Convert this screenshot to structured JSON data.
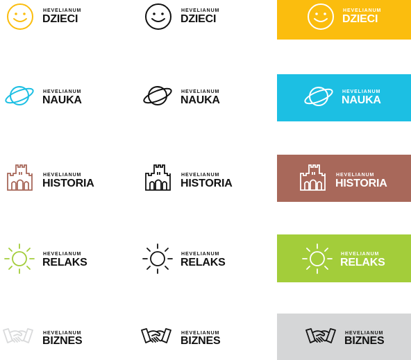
{
  "brand": "HEVELIANUM",
  "colors": {
    "black": "#111111",
    "white": "#ffffff",
    "dzieci": "#fbbd0e",
    "nauka": "#1cbfe3",
    "historia": "#a8685a",
    "relaks": "#a3cd3a",
    "biznes_light": "#d9dadb",
    "biznes_panel": "#d5d6d7"
  },
  "logos": [
    {
      "key": "dzieci",
      "word": "DZIECI",
      "icon": "smiley-icon"
    },
    {
      "key": "nauka",
      "word": "NAUKA",
      "icon": "planet-icon"
    },
    {
      "key": "historia",
      "word": "HISTORIA",
      "icon": "castle-icon"
    },
    {
      "key": "relaks",
      "word": "RELAKS",
      "icon": "sun-icon"
    },
    {
      "key": "biznes",
      "word": "BIZNES",
      "icon": "handshake-icon"
    }
  ]
}
